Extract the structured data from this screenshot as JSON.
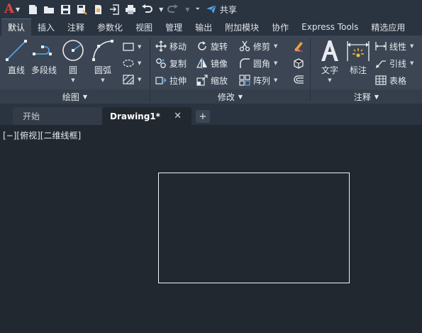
{
  "app": {
    "logo_letter": "A",
    "share_label": "共享"
  },
  "ribbon_tabs": [
    "默认",
    "插入",
    "注释",
    "参数化",
    "视图",
    "管理",
    "输出",
    "附加模块",
    "协作",
    "Express Tools",
    "精选应用"
  ],
  "active_tab_index": 0,
  "panels": {
    "draw": {
      "title": "绘图",
      "line_label": "直线",
      "polyline_label": "多段线",
      "circle_label": "圆",
      "arc_label": "圆弧"
    },
    "modify": {
      "title": "修改",
      "move_label": "移动",
      "rotate_label": "旋转",
      "trim_label": "修剪",
      "copy_label": "复制",
      "mirror_label": "镜像",
      "fillet_label": "圆角",
      "stretch_label": "拉伸",
      "scale_label": "缩放",
      "array_label": "阵列"
    },
    "annotation": {
      "title": "注释",
      "text_label": "文字",
      "dimension_label": "标注",
      "linear_label": "线性",
      "leader_label": "引线",
      "table_label": "表格"
    }
  },
  "file_tabs": {
    "start_label": "开始",
    "doc_label": "Drawing1*",
    "close_glyph": "✕",
    "new_glyph": "+"
  },
  "viewport": {
    "controls_label": "[−][俯视][二维线框]"
  },
  "colors": {
    "accent_red": "#e0433c",
    "ribbon_bg": "#3b4553",
    "canvas_bg": "#212830"
  }
}
